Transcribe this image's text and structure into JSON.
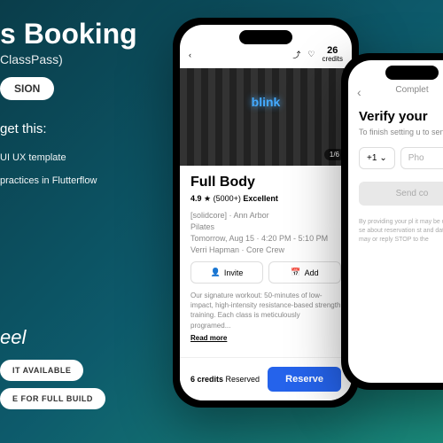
{
  "hero": {
    "title": "s Booking",
    "subtitle": "ClassPass)",
    "version_pill": "SION",
    "get_this": "get this:",
    "feature1": "UI UX template",
    "feature2": "practices in Flutterflow"
  },
  "bottom": {
    "brand": "eel",
    "btn1": "IT AVAILABLE",
    "btn2": "E FOR FULL BUILD"
  },
  "phone1": {
    "credits_num": "26",
    "credits_label": "credits",
    "neon": "blink",
    "counter": "1/6",
    "title": "Full Body",
    "rating": "4.9",
    "rating_count": "(5000+)",
    "rating_word": "Excellent",
    "studio": "[solidcore]",
    "location": "Ann Arbor",
    "type": "Pilates",
    "when": "Tomorrow, Aug 15 · 4:20 PM - 5:10 PM",
    "instructor": "Verri Hapman · Core Crew",
    "invite": "Invite",
    "add": "Add",
    "desc": "Our signature workout: 50-minutes of low-impact, high-intensity resistance-based strength training. Each class is meticulously programed...",
    "readmore": "Read more",
    "footer_credits": "6 credits",
    "footer_status": "Reserved",
    "reserve": "Reserve"
  },
  "phone2": {
    "header": "Complet",
    "back": "‹",
    "title": "Verify your",
    "subtitle": "To finish setting u\nto send you",
    "country_code": "+1",
    "chevron": "⌄",
    "placeholder": "Pho",
    "send": "Send co",
    "legal": "By providing your pl\nit may be used to se\nabout reservation st\nand data rates may\nor reply STOP to the"
  }
}
